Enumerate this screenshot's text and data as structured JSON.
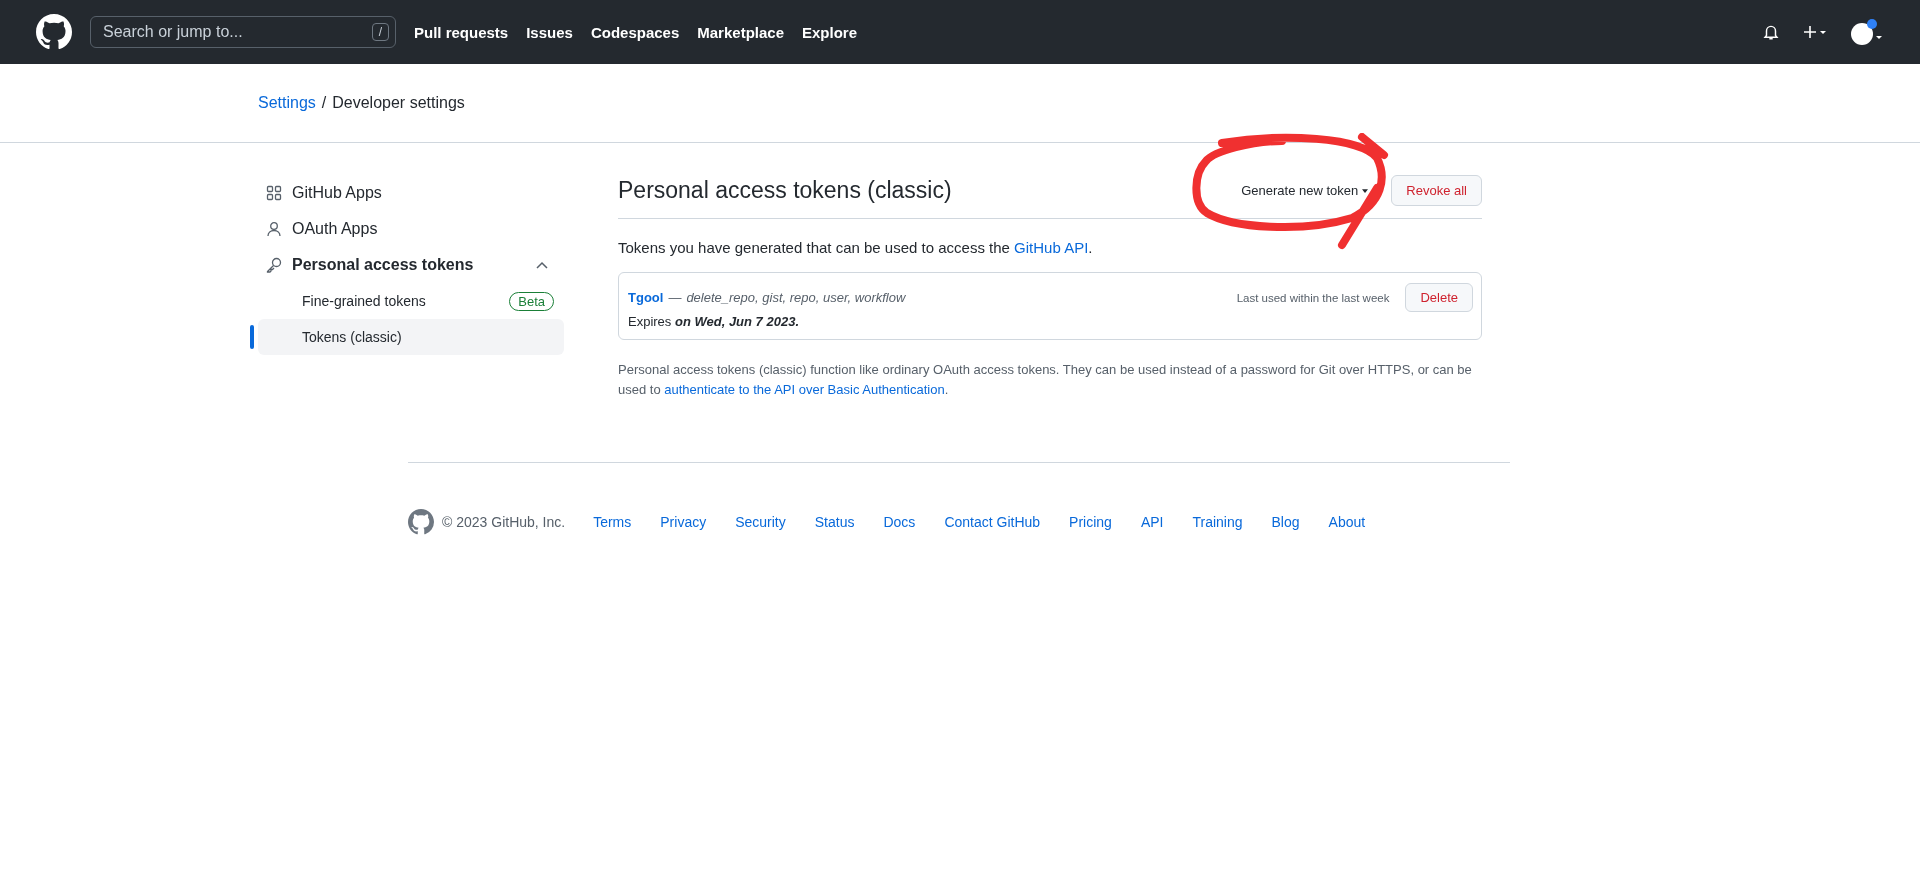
{
  "header": {
    "search": {
      "placeholder": "Search or jump to...",
      "shortcut": "/"
    },
    "nav": [
      "Pull requests",
      "Issues",
      "Codespaces",
      "Marketplace",
      "Explore"
    ]
  },
  "breadcrumb": {
    "items": [
      {
        "label": "Settings",
        "kind": "link"
      },
      {
        "label": "Developer settings",
        "kind": "current"
      }
    ],
    "separator": "/"
  },
  "sidebar": {
    "items": [
      {
        "label": "GitHub Apps",
        "kind": "apps"
      },
      {
        "label": "OAuth Apps",
        "kind": "person"
      },
      {
        "label": "Personal access tokens",
        "kind": "key",
        "expanded": true,
        "children": [
          {
            "label": "Fine-grained tokens",
            "badge": "Beta",
            "selected": false
          },
          {
            "label": "Tokens (classic)",
            "selected": true
          }
        ]
      }
    ]
  },
  "main": {
    "title": "Personal access tokens (classic)",
    "buttons": [
      {
        "label": "Generate new token",
        "kind": "dropdown"
      },
      {
        "label": "Revoke all",
        "kind": "danger"
      }
    ],
    "intro": {
      "text": "Tokens you have generated that can be used to access the ",
      "link": "GitHub API",
      "after": "."
    },
    "tokens": [
      {
        "name": "Tgool",
        "separator": "—",
        "scopes": "delete_repo, gist, repo, user, workflow",
        "last_used": "Last used within the last week",
        "delete": "Delete",
        "expires": "Expires **on Wed, Jun 7 2023.**"
      }
    ],
    "note": {
      "text": "Personal access tokens (classic) function like ordinary OAuth access tokens. They can be used instead of a password for Git over HTTPS, or can be used to ",
      "link": "authenticate to the API over Basic Authentication",
      "after": "."
    }
  },
  "footer": {
    "copyright": "© 2023 GitHub, Inc.",
    "links": [
      "Terms",
      "Privacy",
      "Security",
      "Status",
      "Docs",
      "Contact GitHub",
      "Pricing",
      "API",
      "Training",
      "Blog",
      "About"
    ]
  }
}
